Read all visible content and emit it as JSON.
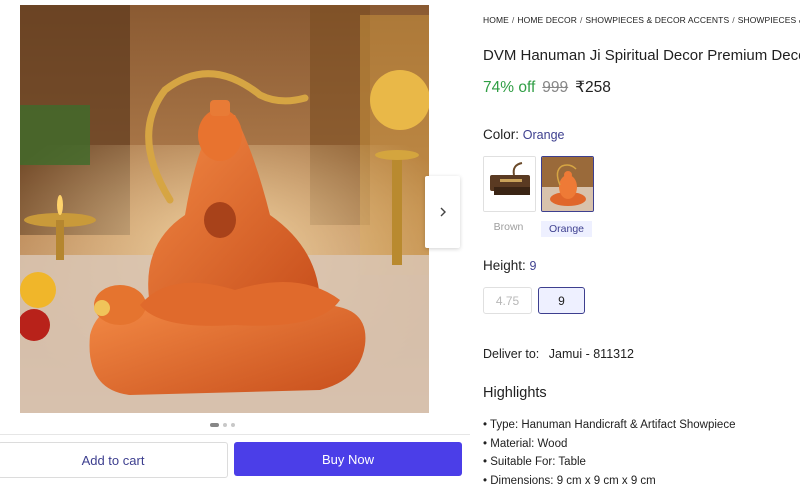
{
  "breadcrumb": [
    "HOME",
    "HOME DECOR",
    "SHOWPIECES & DECOR ACCENTS",
    "SHOWPIECES & FIGURINES"
  ],
  "product": {
    "title": "DVM Hanuman Ji Spiritual Decor Premium Decorative Showpiece",
    "discount": "74% off",
    "mrp": "999",
    "price": "₹258"
  },
  "color": {
    "label": "Color:",
    "selected": "Orange",
    "options": [
      "Brown",
      "Orange"
    ]
  },
  "height": {
    "label": "Height:",
    "selected": "9",
    "options": [
      "4.75",
      "9"
    ]
  },
  "delivery": {
    "label": "Deliver to:",
    "location": "Jamui - 811312"
  },
  "highlights": {
    "title": "Highlights",
    "items": [
      "Type: Hanuman Handicraft & Artifact Showpiece",
      "Material: Wood",
      "Suitable For: Table",
      "Dimensions: 9 cm x 9 cm x 9 cm"
    ]
  },
  "actions": {
    "add_to_cart": "Add to cart",
    "buy_now": "Buy Now"
  },
  "gallery": {
    "image_count": 3,
    "active_index": 0,
    "next_icon": "chevron-right-icon"
  },
  "colors": {
    "accent": "#4b3ee8",
    "link": "#3d3f8f",
    "discount": "#2f9e44",
    "statue_orange": "#e0662a"
  }
}
